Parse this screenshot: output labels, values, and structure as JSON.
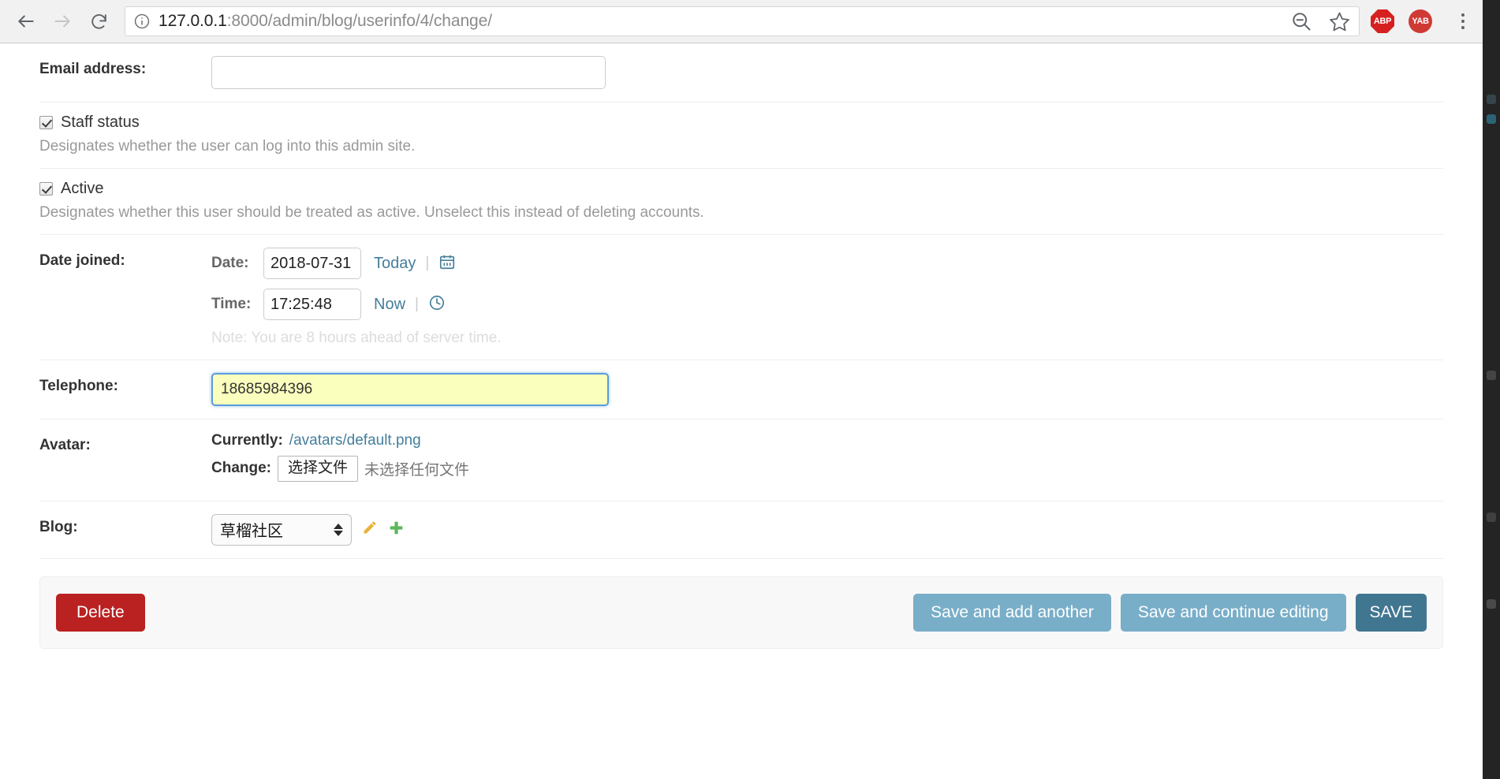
{
  "browser": {
    "back_label": "Back",
    "forward_label": "Forward",
    "reload_label": "Reload",
    "url_host": "127.0.0.1",
    "url_path": ":8000/admin/blog/userinfo/4/change/",
    "zoom_icon": "zoom-out-icon",
    "bookmark_icon": "star-icon",
    "extensions": [
      {
        "name": "abp",
        "label": "ABP",
        "color": "#d62020"
      },
      {
        "name": "yab",
        "label": "YAB",
        "color": "#cf3a34"
      }
    ],
    "menu_label": "Customize and control"
  },
  "form": {
    "email": {
      "label": "Email address:",
      "value": "",
      "placeholder": ""
    },
    "staff_status": {
      "label": "Staff status",
      "checked": true,
      "help": "Designates whether the user can log into this admin site."
    },
    "active": {
      "label": "Active",
      "checked": true,
      "help": "Designates whether this user should be treated as active. Unselect this instead of deleting accounts."
    },
    "date_joined": {
      "label": "Date joined:",
      "date_caption": "Date:",
      "date_value": "2018-07-31",
      "today_link": "Today",
      "separator": "|",
      "calendar_icon": "calendar-icon",
      "time_caption": "Time:",
      "time_value": "17:25:48",
      "now_link": "Now",
      "clock_icon": "clock-icon",
      "note": "Note: You are 8 hours ahead of server time."
    },
    "telephone": {
      "label": "Telephone:",
      "value": "18685984396",
      "autofill_color": "#faffbd",
      "focus_color": "#5b9dd9"
    },
    "avatar": {
      "label": "Avatar:",
      "currently_caption": "Currently:",
      "currently_value": "/avatars/default.png",
      "change_caption": "Change:",
      "file_button": "选择文件",
      "file_status": "未选择任何文件"
    },
    "blog": {
      "label": "Blog:",
      "selected": "草榴社区",
      "edit_icon": "pencil-icon",
      "add_icon": "plus-icon"
    }
  },
  "actions": {
    "delete": "Delete",
    "save_add_another": "Save and add another",
    "save_continue": "Save and continue editing",
    "save": "SAVE",
    "delete_color": "#ba2121",
    "save_light_color": "#79aec8",
    "save_color": "#417690"
  }
}
